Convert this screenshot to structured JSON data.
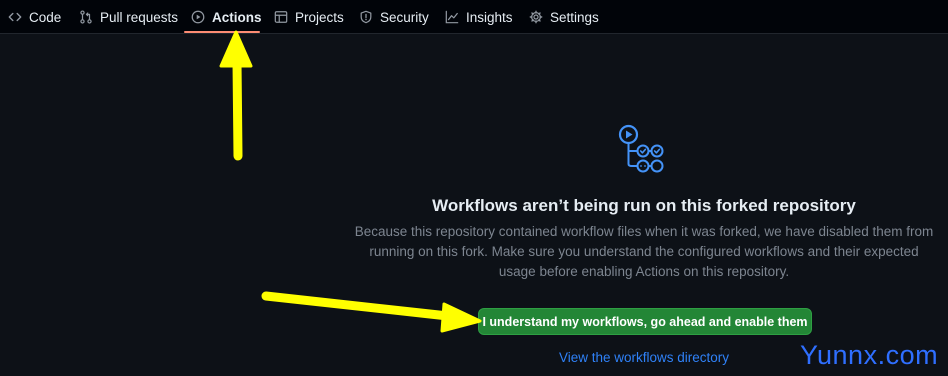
{
  "nav": {
    "tabs": [
      {
        "label": "Code",
        "icon": "code-icon"
      },
      {
        "label": "Pull requests",
        "icon": "pull-request-icon"
      },
      {
        "label": "Actions",
        "icon": "play-icon",
        "active": true
      },
      {
        "label": "Projects",
        "icon": "table-icon"
      },
      {
        "label": "Security",
        "icon": "shield-icon"
      },
      {
        "label": "Insights",
        "icon": "graph-icon"
      },
      {
        "label": "Settings",
        "icon": "gear-icon"
      }
    ],
    "active_underline_color": "#fd8c73"
  },
  "blankslate": {
    "icon": "workflow-icon",
    "heading": "Workflows aren’t being run on this forked repository",
    "description_lines": [
      "Because this repository contained workflow files when it was forked, we have disabled them from",
      "running on this fork. Make sure you understand the configured workflows and their expected",
      "usage before enabling Actions on this repository."
    ],
    "enable_button_label": "I understand my workflows, go ahead and enable them",
    "view_link_label": "View the workflows directory"
  },
  "annotations": {
    "arrow_color": "#ffff00",
    "watermark": "Yunnx.com"
  },
  "colors": {
    "background": "#0d1117",
    "nav_background": "#010409",
    "button_green": "#238636",
    "link_blue": "#2f81f7",
    "muted_text": "#7d8590"
  }
}
